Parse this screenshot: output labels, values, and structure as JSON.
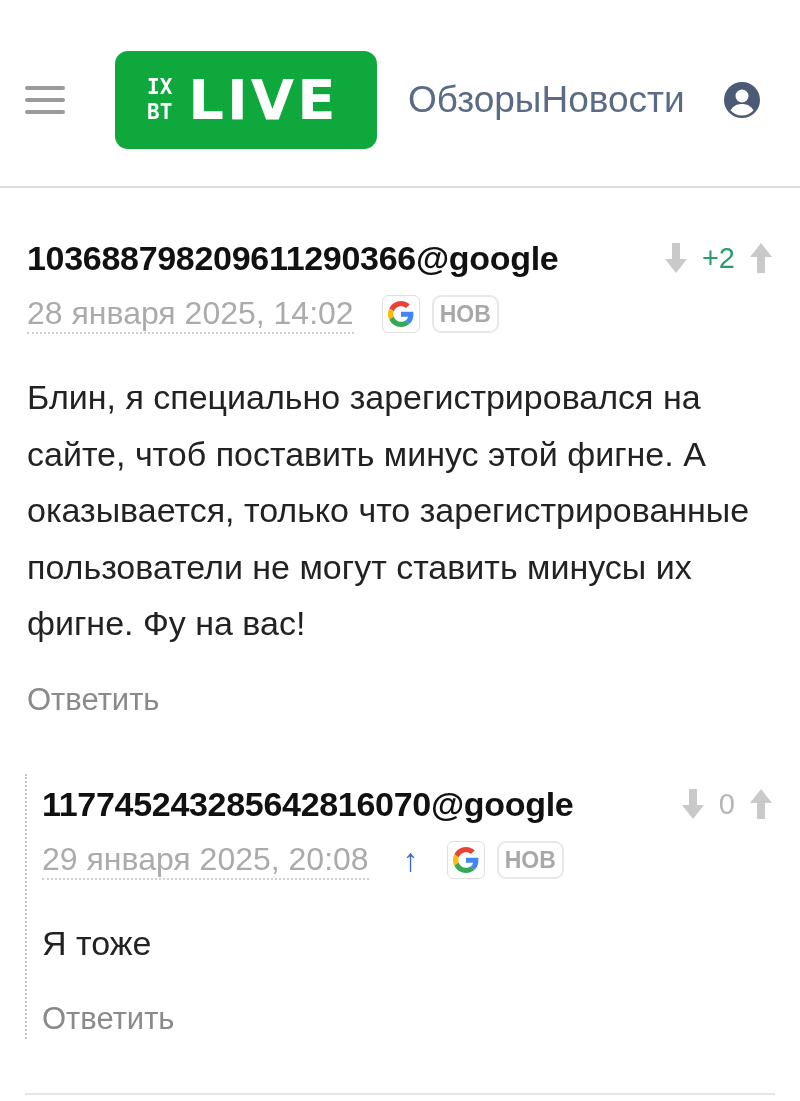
{
  "header": {
    "logo": {
      "small_top": "IX",
      "small_bottom": "BT",
      "main": "LIVE"
    },
    "nav": [
      {
        "label": "Обзоры"
      },
      {
        "label": "Новости"
      }
    ]
  },
  "comments": [
    {
      "author": "103688798209611290366@google",
      "date": "28 января 2025, 14:02",
      "google_account": true,
      "badge": "НОВ",
      "score": "+2",
      "score_positive": true,
      "body": "Блин, я специально зарегистрировался на сайте, чтоб поставить минус этой фигне. А оказывается, только что зарегистрированные пользователи не могут ставить минусы их фигне. Фу на вас!",
      "reply_label": "Ответить",
      "children": [
        {
          "author": "117745243285642816070@google",
          "date": "29 января 2025, 20:08",
          "parent_link": "↑",
          "google_account": true,
          "badge": "НОВ",
          "score": "0",
          "score_positive": false,
          "body": "Я тоже",
          "reply_label": "Ответить"
        }
      ]
    }
  ]
}
